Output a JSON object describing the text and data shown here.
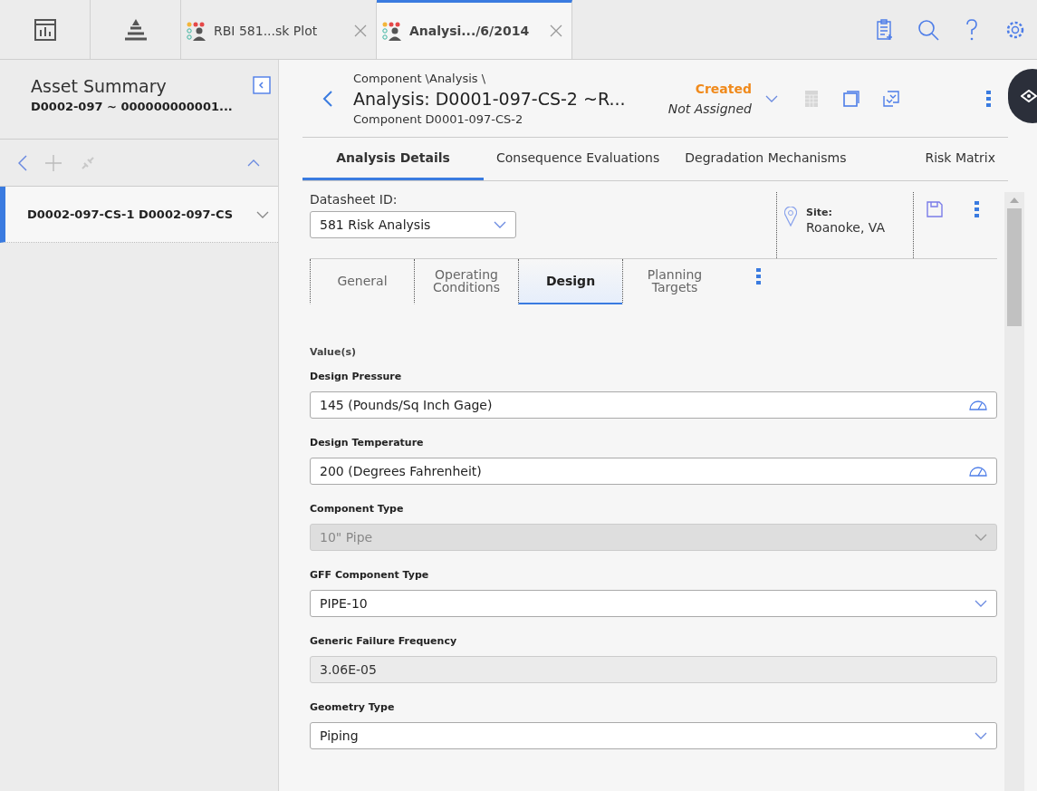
{
  "top_tabs": [
    {
      "label": "RBI 581...sk Plot",
      "selected": false
    },
    {
      "label": "Analysi.../6/2014",
      "selected": true
    }
  ],
  "sidebar": {
    "title": "Asset Summary",
    "subtitle": "D0002-097 ~ 000000000001...",
    "items": [
      {
        "label": "D0002-097-CS-1 D0002-097-CS",
        "selected": true
      }
    ]
  },
  "header": {
    "breadcrumb": "Component \\Analysis \\",
    "title": "Analysis: D0001-097-CS-2 ~R...",
    "subtitle": "Component D0001-097-CS-2",
    "status": "Created",
    "assignee": "Not Assigned"
  },
  "tabs": [
    {
      "label": "Analysis Details",
      "selected": true
    },
    {
      "label": "Consequence Evaluations",
      "selected": false
    },
    {
      "label": "Degradation Mechanisms",
      "selected": false
    },
    {
      "label": "Risk Matrix",
      "selected": false
    }
  ],
  "datasheet": {
    "label": "Datasheet ID:",
    "value": "581 Risk Analysis"
  },
  "site": {
    "label": "Site:",
    "value": "Roanoke, VA"
  },
  "section_tabs": [
    {
      "label": "General",
      "selected": false
    },
    {
      "label": "Operating Conditions",
      "selected": false
    },
    {
      "label": "Design",
      "selected": true
    },
    {
      "label": "Planning Targets",
      "selected": false
    }
  ],
  "section_title": "Value(s)",
  "fields": [
    {
      "label": "Design Pressure",
      "value": "145 (Pounds/Sq Inch Gage)",
      "kind": "measure",
      "disabled": false
    },
    {
      "label": "Design Temperature",
      "value": "200 (Degrees Fahrenheit)",
      "kind": "measure",
      "disabled": false
    },
    {
      "label": "Component Type",
      "value": "10\" Pipe",
      "kind": "select",
      "disabled": true
    },
    {
      "label": "GFF Component Type",
      "value": "PIPE-10",
      "kind": "select",
      "disabled": false
    },
    {
      "label": "Generic Failure Frequency",
      "value": "3.06E-05",
      "kind": "readonly",
      "disabled": true
    },
    {
      "label": "Geometry Type",
      "value": "Piping",
      "kind": "select",
      "disabled": false
    }
  ]
}
